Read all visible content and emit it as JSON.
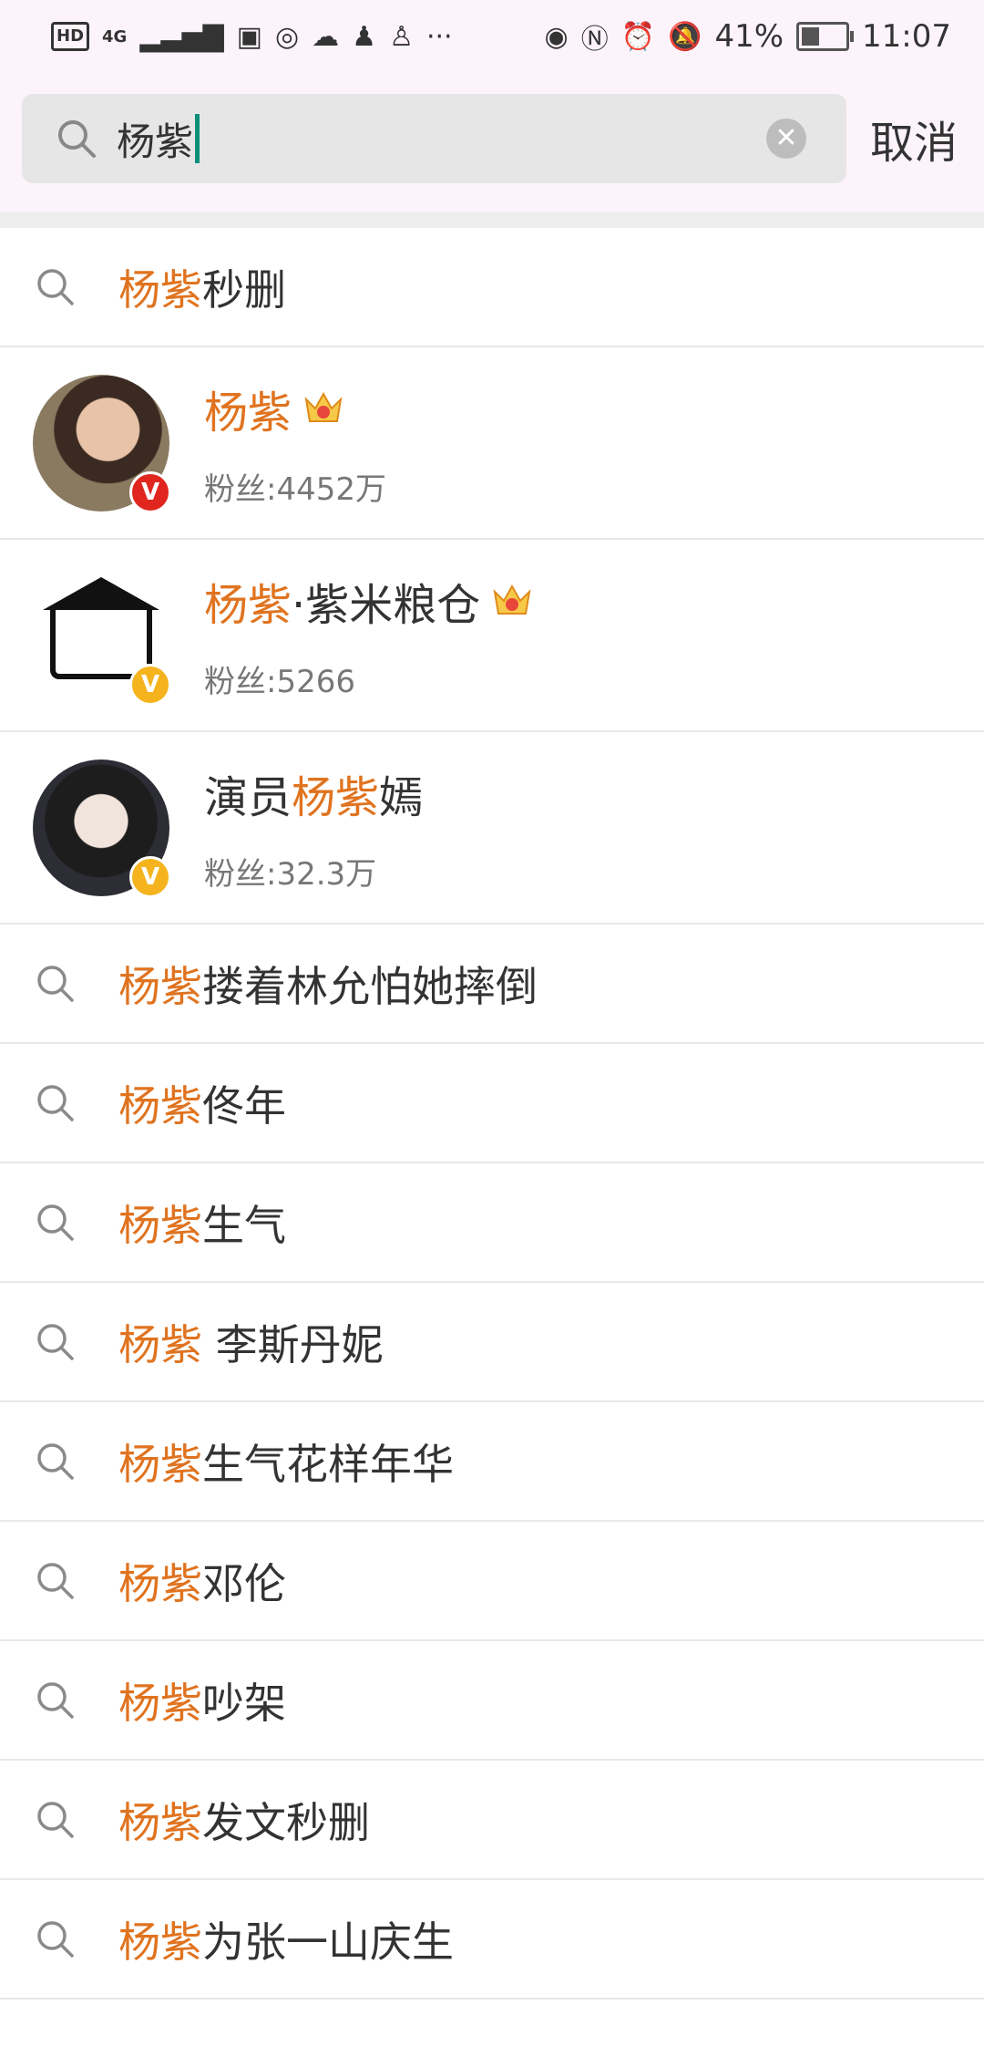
{
  "status_bar": {
    "hd": "HD",
    "network": "4G",
    "battery": "41%",
    "time": "11:07",
    "battery_level": 0.41
  },
  "search": {
    "query": "杨紫",
    "cancel_label": "取消"
  },
  "colors": {
    "highlight": "#e0731f",
    "red_badge": "#e0261f",
    "yellow_badge": "#f5b41d",
    "caret": "#0a8f7a"
  },
  "items": [
    {
      "type": "query",
      "hl": "杨紫",
      "rest": "秒删"
    },
    {
      "type": "user",
      "prefix": "",
      "hl": "杨紫",
      "suffix": "",
      "fans": "粉丝:4452万",
      "badge": "red",
      "crown": "6"
    },
    {
      "type": "user",
      "prefix": "",
      "hl": "杨紫",
      "suffix": "·紫米粮仓",
      "fans": "粉丝:5266",
      "badge": "yellow",
      "crown": "5"
    },
    {
      "type": "user",
      "prefix": "演员",
      "hl": "杨紫",
      "suffix": "嫣",
      "fans": "粉丝:32.3万",
      "badge": "yellow",
      "crown": ""
    },
    {
      "type": "query",
      "hl": "杨紫",
      "rest": "搂着林允怕她摔倒"
    },
    {
      "type": "query",
      "hl": "杨紫",
      "rest": "佟年"
    },
    {
      "type": "query",
      "hl": "杨紫",
      "rest": "生气"
    },
    {
      "type": "query",
      "hl": "杨紫",
      "rest": " 李斯丹妮"
    },
    {
      "type": "query",
      "hl": "杨紫",
      "rest": "生气花样年华"
    },
    {
      "type": "query",
      "hl": "杨紫",
      "rest": "邓伦"
    },
    {
      "type": "query",
      "hl": "杨紫",
      "rest": "吵架"
    },
    {
      "type": "query",
      "hl": "杨紫",
      "rest": "发文秒删"
    },
    {
      "type": "query",
      "hl": "杨紫",
      "rest": "为张一山庆生"
    }
  ]
}
